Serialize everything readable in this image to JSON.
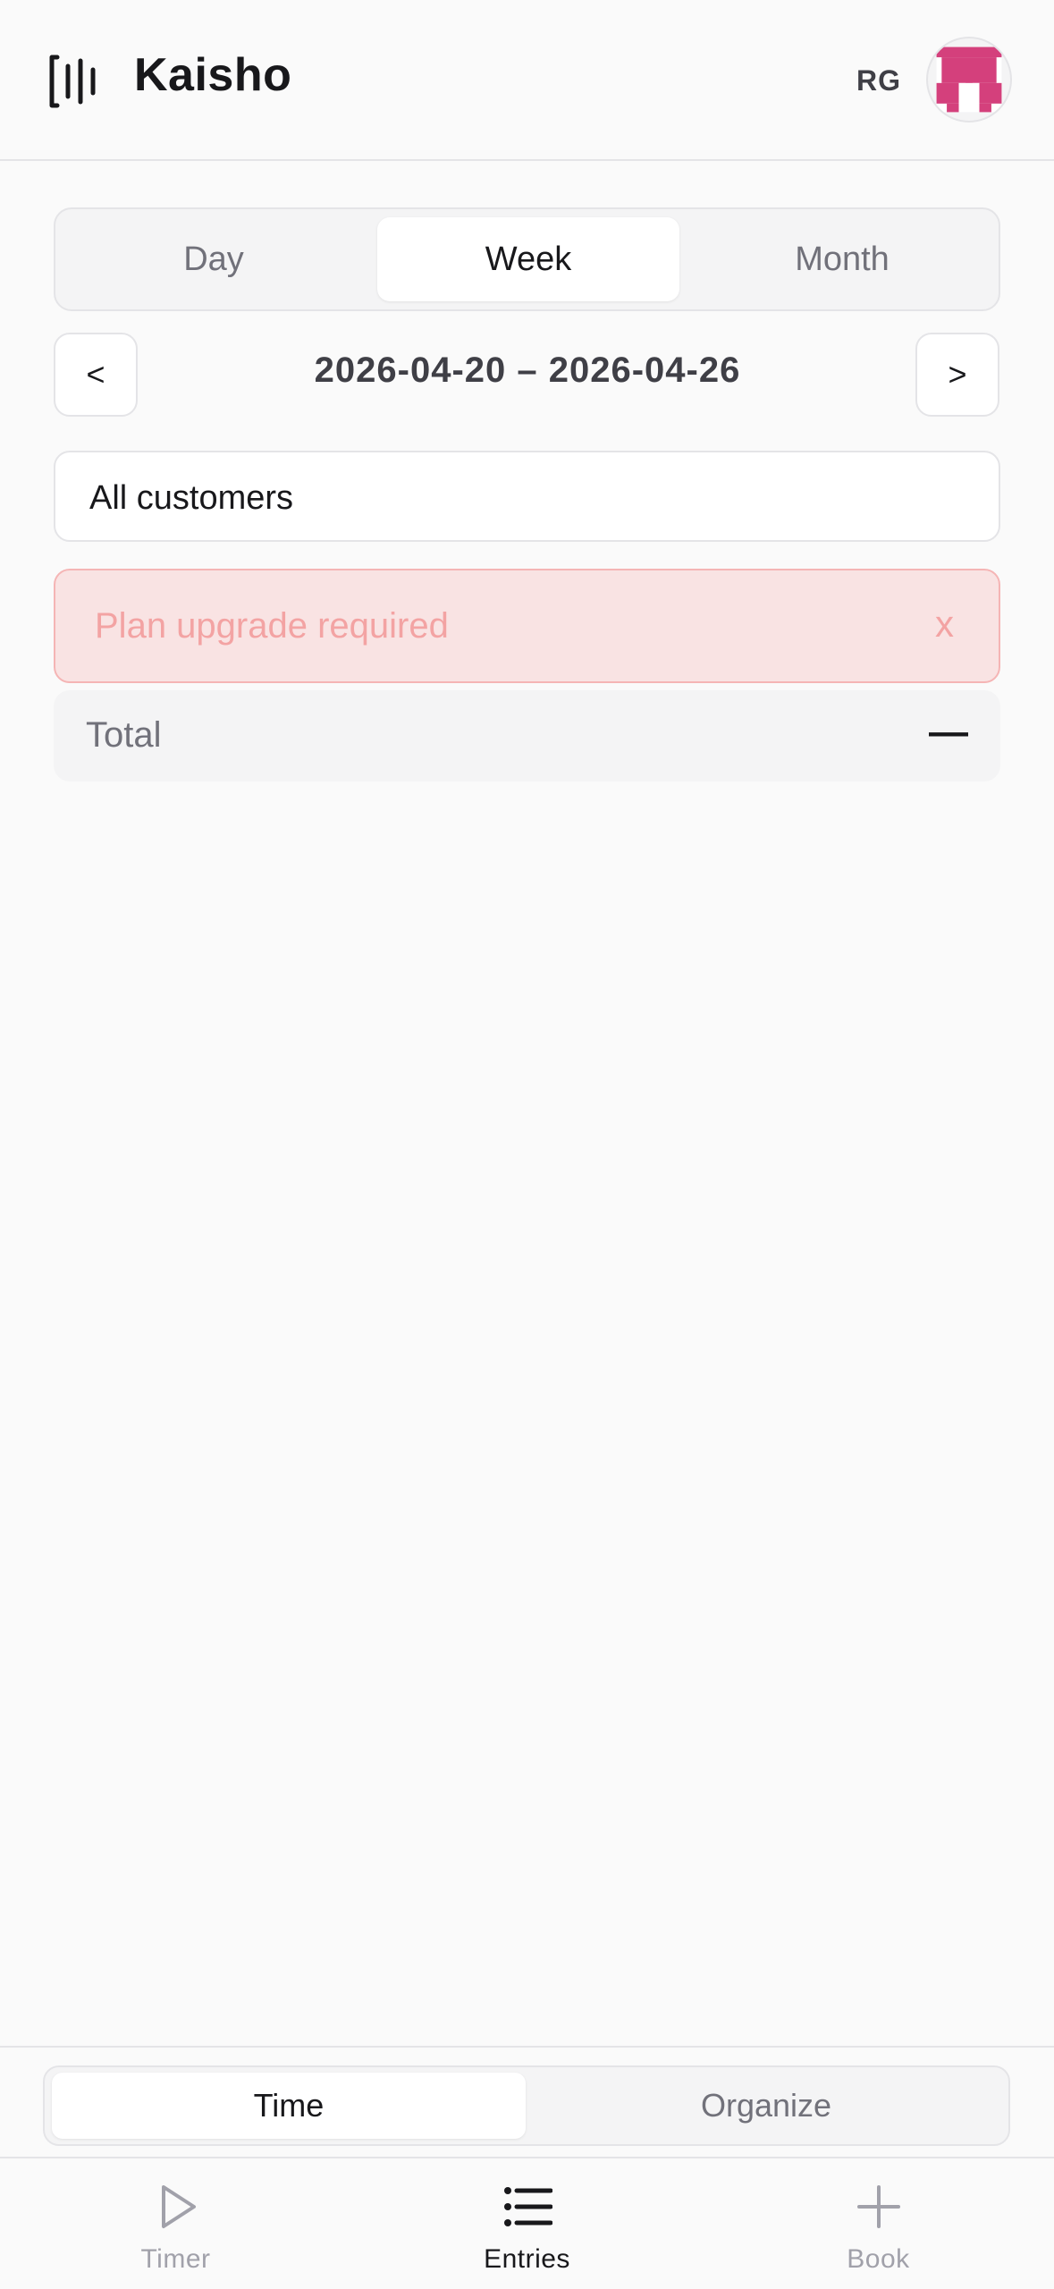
{
  "header": {
    "title": "Kaisho",
    "initials": "RG",
    "logo_icon": "timeline-bars-icon",
    "avatar_icon": "pixel-avatar-icon"
  },
  "period_tabs": [
    {
      "label": "Day",
      "active": false
    },
    {
      "label": "Week",
      "active": true
    },
    {
      "label": "Month",
      "active": false
    }
  ],
  "date_nav": {
    "prev_label": "<",
    "next_label": ">",
    "range": "2026-04-20 – 2026-04-26"
  },
  "customer_filter": {
    "value": "All customers"
  },
  "alert": {
    "message": "Plan upgrade required",
    "close_label": "x"
  },
  "total": {
    "label": "Total",
    "value": "—"
  },
  "mode_tabs": [
    {
      "label": "Time",
      "active": true
    },
    {
      "label": "Organize",
      "active": false
    }
  ],
  "bottom_nav": [
    {
      "label": "Timer",
      "icon": "play-icon",
      "active": false
    },
    {
      "label": "Entries",
      "icon": "list-icon",
      "active": true
    },
    {
      "label": "Book",
      "icon": "plus-icon",
      "active": false
    }
  ],
  "colors": {
    "accent_avatar": "#d4407c",
    "alert_bg": "#f9e3e3",
    "alert_text": "#f3a3a3"
  }
}
